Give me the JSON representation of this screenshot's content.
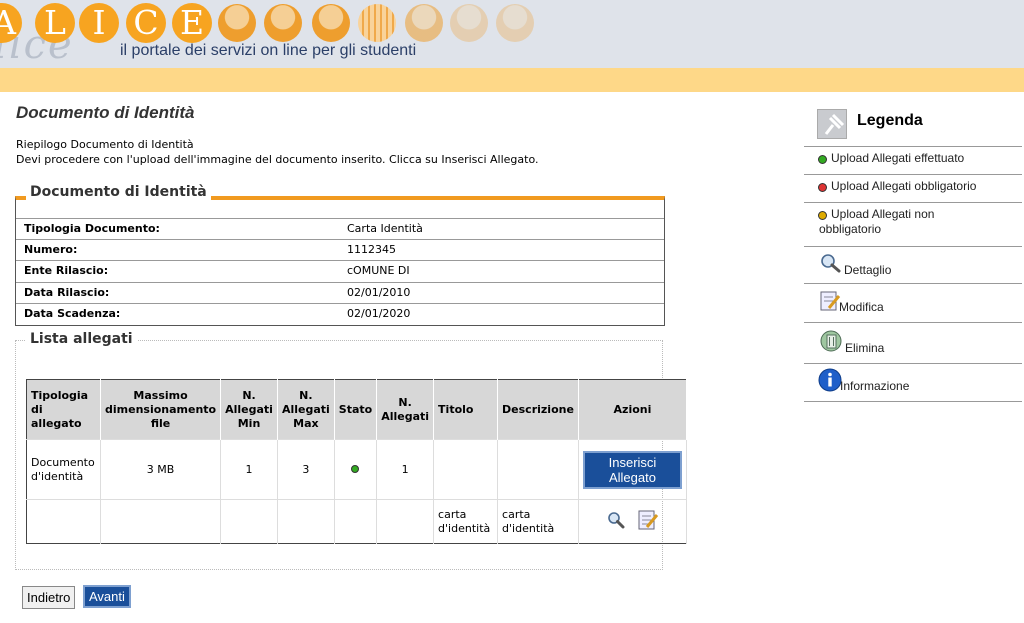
{
  "header": {
    "logo_letters": [
      "A",
      "L",
      "I",
      "C",
      "E"
    ],
    "logo_script": "lice",
    "tagline": "il portale dei servizi on line per gli studenti"
  },
  "page": {
    "title": "Documento di Identità",
    "intro_line1": "Riepilogo Documento di Identità",
    "intro_line2": "Devi procedere con l'upload dell'immagine del documento inserito. Clicca su Inserisci Allegato."
  },
  "document": {
    "legend": "Documento di Identità",
    "fields": [
      {
        "label": "Tipologia Documento:",
        "value": "Carta Identità"
      },
      {
        "label": "Numero:",
        "value": "1112345"
      },
      {
        "label": "Ente Rilascio:",
        "value": "cOMUNE DI"
      },
      {
        "label": "Data Rilascio:",
        "value": "02/01/2010"
      },
      {
        "label": "Data Scadenza:",
        "value": "02/01/2020"
      }
    ]
  },
  "attachments": {
    "legend": "Lista allegati",
    "headers": {
      "tipologia": "Tipologia di allegato",
      "massimo": "Massimo dimensionamento file",
      "min": "N. Allegati Min",
      "max": "N. Allegati Max",
      "stato": "Stato",
      "n": "N. Allegati",
      "titolo": "Titolo",
      "descrizione": "Descrizione",
      "azioni": "Azioni"
    },
    "row": {
      "tipologia": "Documento d'identità",
      "massimo": "3 MB",
      "min": "1",
      "max": "3",
      "stato_color": "#33aa22",
      "n": "1",
      "button": "Inserisci Allegato"
    },
    "sub_row": {
      "titolo": "carta d'identità",
      "descrizione": "carta d'identità",
      "icons": [
        "magnifier-icon",
        "edit-icon"
      ]
    }
  },
  "nav": {
    "back": "Indietro",
    "next": "Avanti"
  },
  "legend": {
    "title": "Legenda",
    "items": [
      {
        "label": "Upload Allegati effettuato",
        "color": "#33aa22"
      },
      {
        "label": "Upload Allegati obbligatorio",
        "color": "#dd3333"
      },
      {
        "label": "Upload Allegati non obbligatorio",
        "color": "#ddaa00"
      }
    ],
    "actions": [
      {
        "label": "Dettaglio",
        "icon": "magnifier-icon"
      },
      {
        "label": "Modifica",
        "icon": "edit-icon"
      },
      {
        "label": "Elimina",
        "icon": "trash-icon"
      },
      {
        "label": "Informazione",
        "icon": "info-icon"
      }
    ]
  },
  "colors": {
    "accent_orange": "#f19a20",
    "header_band": "#fed888",
    "button_blue": "#1a4f9a"
  }
}
